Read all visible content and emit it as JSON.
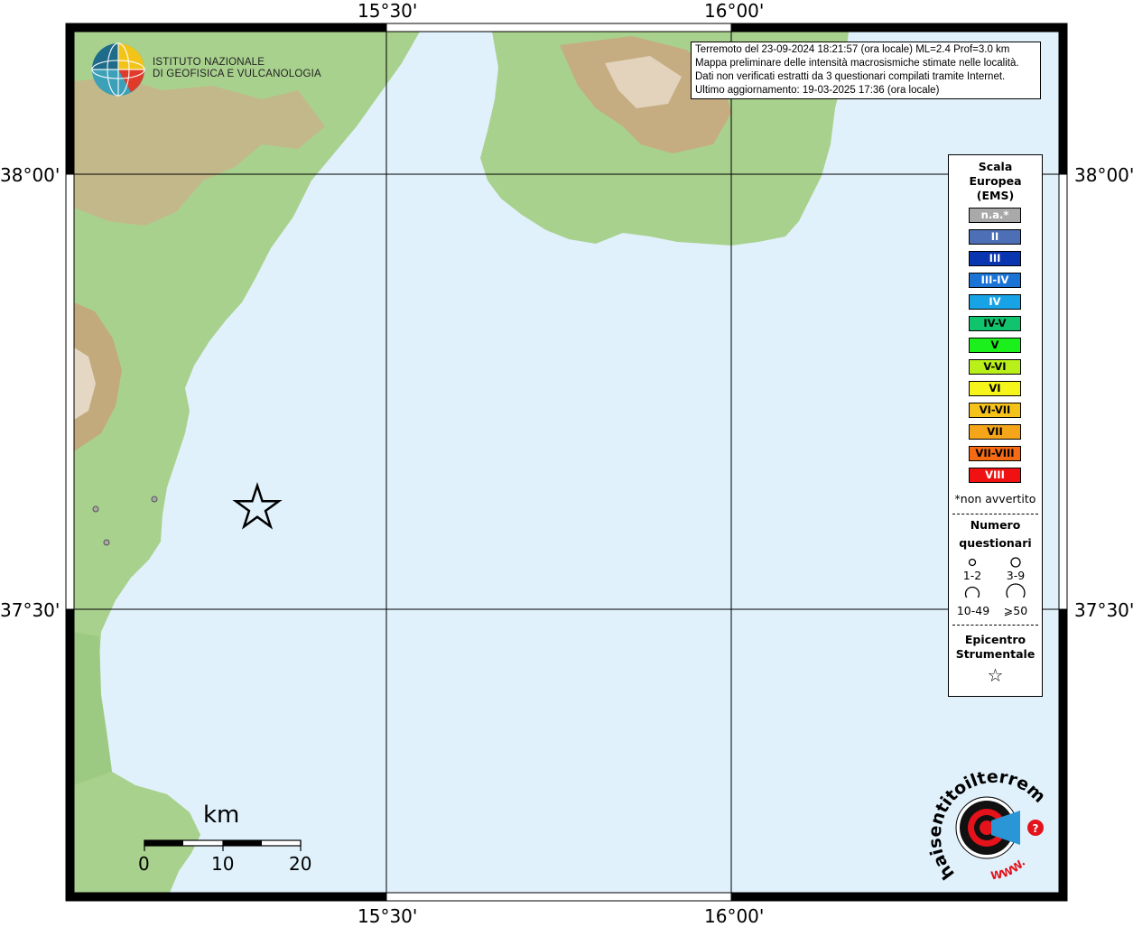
{
  "coords": {
    "top": [
      "15°30'",
      "16°00'"
    ],
    "bottom": [
      "15°30'",
      "16°00'"
    ],
    "left": [
      "38°00'",
      "37°30'"
    ],
    "right": [
      "38°00'",
      "37°30'"
    ]
  },
  "institute": {
    "line1": "ISTITUTO NAZIONALE",
    "line2": "DI GEOFISICA E VULCANOLOGIA"
  },
  "info": {
    "line1": "Terremoto del 23-09-2024 18:21:57 (ora locale) ML=2.4 Prof=3.0 km",
    "line2": "Mappa preliminare delle intensità macrosismiche stimate nelle località.",
    "line3": "Dati non verificati estratti da 3 questionari compilati tramite Internet.",
    "line4": "Ultimo aggiornamento: 19-03-2025 17:36 (ora locale)"
  },
  "legend": {
    "title1": "Scala",
    "title2": "Europea",
    "title3": "(EMS)",
    "ems": [
      {
        "label": "n.a.*",
        "color": "#a9a9a9",
        "text_color": "#ffffff"
      },
      {
        "label": "II",
        "color": "#4d6fb5",
        "text_color": "#ffffff"
      },
      {
        "label": "III",
        "color": "#0a35b0",
        "text_color": "#ffffff"
      },
      {
        "label": "III-IV",
        "color": "#1c73d6",
        "text_color": "#ffffff"
      },
      {
        "label": "IV",
        "color": "#18a3e6",
        "text_color": "#ffffff"
      },
      {
        "label": "IV-V",
        "color": "#10c46e",
        "text_color": "#000000"
      },
      {
        "label": "V",
        "color": "#1cf01c",
        "text_color": "#000000"
      },
      {
        "label": "V-VI",
        "color": "#b9f01a",
        "text_color": "#000000"
      },
      {
        "label": "VI",
        "color": "#f5f51c",
        "text_color": "#000000"
      },
      {
        "label": "VI-VII",
        "color": "#f5c21a",
        "text_color": "#000000"
      },
      {
        "label": "VII",
        "color": "#f5a51a",
        "text_color": "#000000"
      },
      {
        "label": "VII-VIII",
        "color": "#f56a12",
        "text_color": "#000000"
      },
      {
        "label": "VIII",
        "color": "#f01212",
        "text_color": "#ffffff"
      }
    ],
    "note": "*non avvertito",
    "count_title1": "Numero",
    "count_title2": "questionari",
    "count_labels": [
      "1-2",
      "3-9",
      "10-49",
      "⩾50"
    ],
    "epi_title1": "Epicentro",
    "epi_title2": "Strumentale",
    "epi_symbol": "☆"
  },
  "scale": {
    "title": "km",
    "labels": [
      "0",
      "10",
      "20"
    ]
  },
  "badge": {
    "text": "haisentitoilterremoto.it",
    "www": "WWW.",
    "question": "?"
  },
  "colors": {
    "sea": "#e0f1fc",
    "land": "#a9d18e",
    "mountain": "#c9a77d",
    "grid": "#000000",
    "epicenter": "#000000",
    "badge_red": "#e3121b"
  }
}
